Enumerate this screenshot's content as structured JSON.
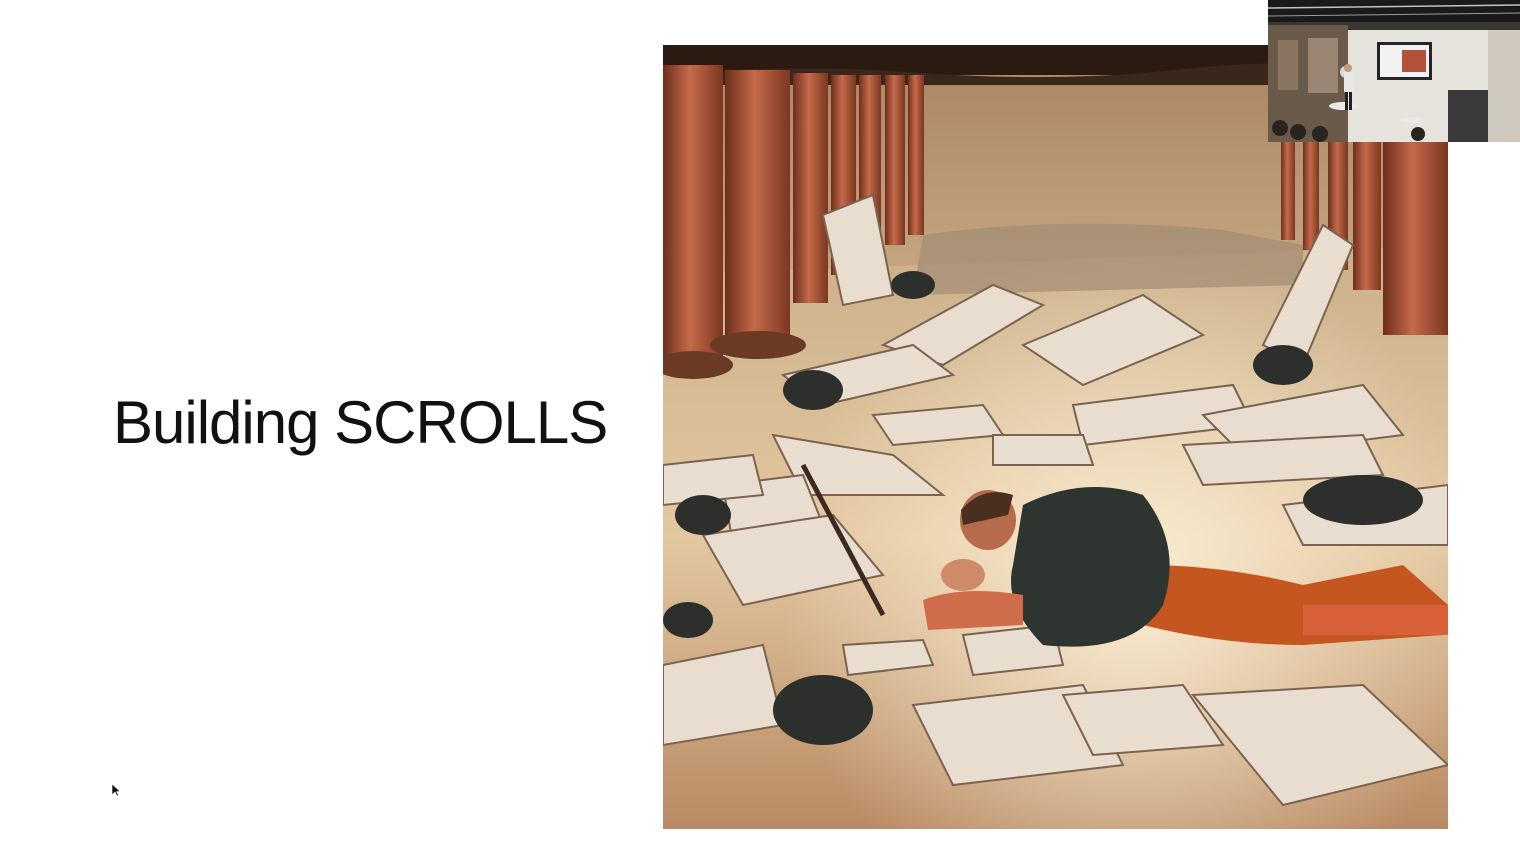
{
  "slide": {
    "title": "Building SCROLLS"
  },
  "painting": {
    "icon": "ai-generated-painting-scrolls-library",
    "watermark_colors": [
      "#f5e64a",
      "#66e3d9",
      "#5fd160",
      "#ef5b48",
      "#4a63e6"
    ]
  },
  "webcam": {
    "icon": "presenter-webcam-thumbnail"
  },
  "cursor": {
    "icon": "mouse-pointer-icon"
  }
}
